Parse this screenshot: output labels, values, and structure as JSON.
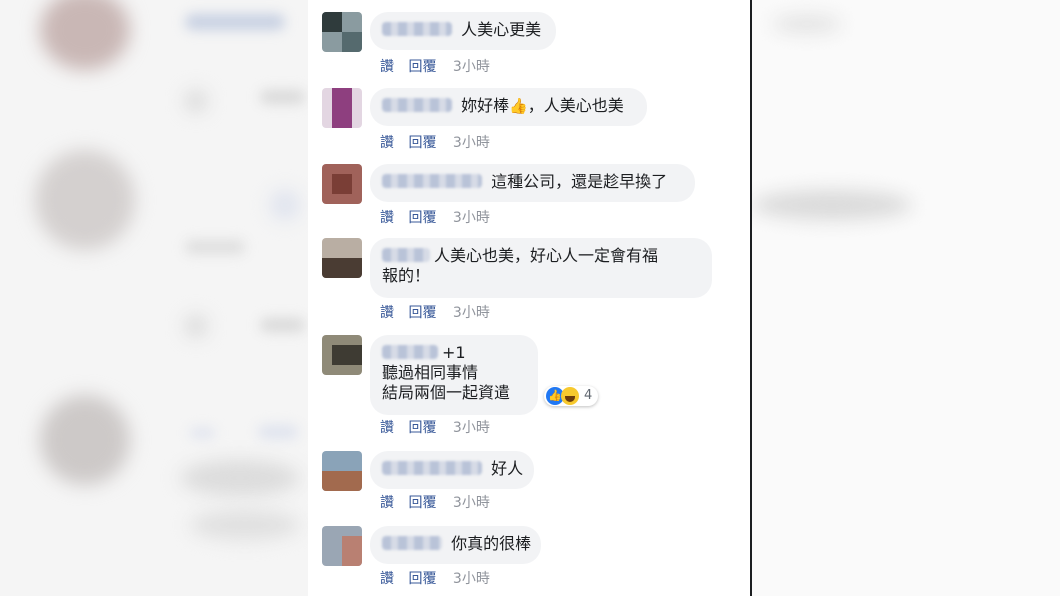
{
  "comments": [
    {
      "text": "人美心更美",
      "actions": {
        "like": "讚",
        "reply": "回覆",
        "time": "3小時"
      }
    },
    {
      "text_before": "妳好棒",
      "emoji": "👍",
      "text_after": "，人美心也美",
      "actions": {
        "like": "讚",
        "reply": "回覆",
        "time": "3小時"
      }
    },
    {
      "text": "這種公司，還是趁早換了",
      "actions": {
        "like": "讚",
        "reply": "回覆",
        "time": "3小時"
      }
    },
    {
      "line1": "人美心也美，好心人一定會有福",
      "line2": "報的！",
      "actions": {
        "like": "讚",
        "reply": "回覆",
        "time": "3小時"
      }
    },
    {
      "line1": "+1",
      "line2": "聽過相同事情",
      "line3": "結局兩個一起資遣",
      "reaction_count": "4",
      "actions": {
        "like": "讚",
        "reply": "回覆",
        "time": "3小時"
      }
    },
    {
      "text": "好人",
      "actions": {
        "like": "讚",
        "reply": "回覆",
        "time": "3小時"
      }
    },
    {
      "text": "你真的很棒",
      "actions": {
        "like": "讚",
        "reply": "回覆",
        "time": "3小時"
      }
    }
  ],
  "colors": {
    "link": "#385898",
    "meta": "#90949c",
    "bubble": "#f2f3f5",
    "divider": "#1c1e21"
  }
}
